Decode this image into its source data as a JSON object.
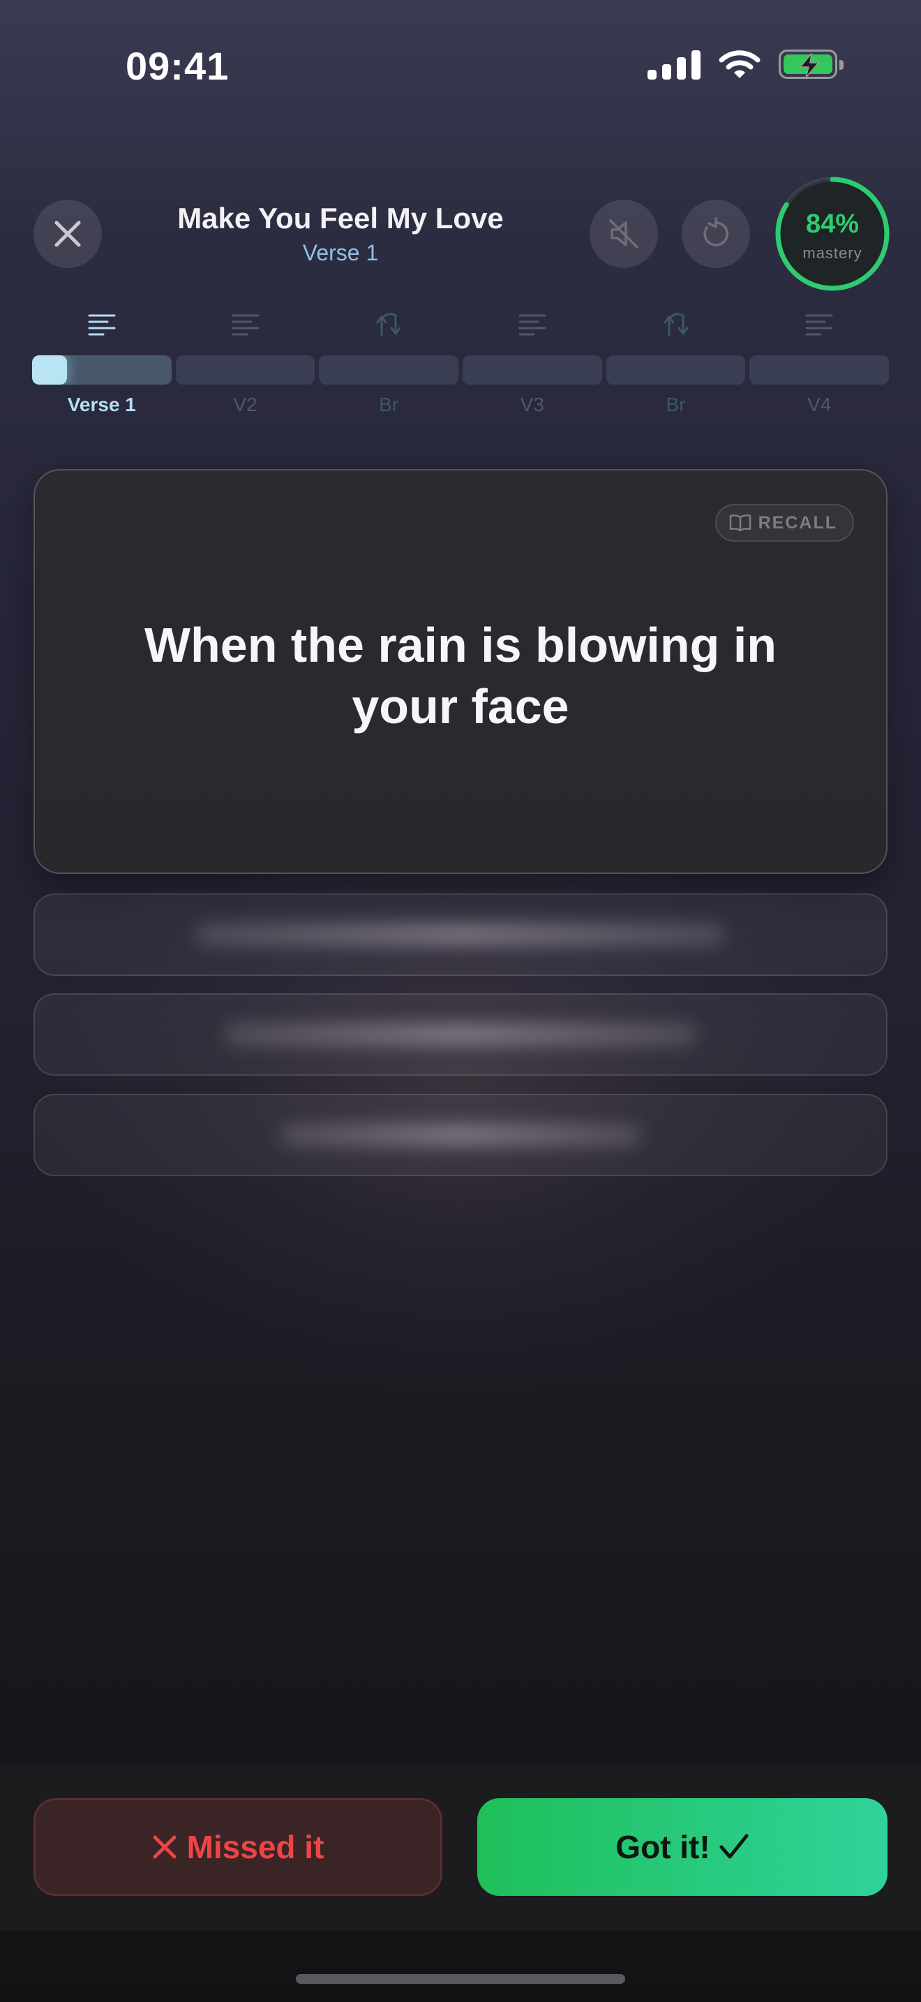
{
  "status_bar": {
    "time": "09:41"
  },
  "header": {
    "song_title": "Make You Feel My Love",
    "section": "Verse 1",
    "mastery_percent": "84%",
    "mastery_value": 0.84,
    "mastery_label": "mastery"
  },
  "progress": {
    "segments": [
      {
        "label": "Verse 1",
        "kind": "verse",
        "state": "current",
        "fill_fraction": 0.25
      },
      {
        "label": "V2",
        "kind": "verse",
        "state": "upcoming",
        "fill_fraction": 0
      },
      {
        "label": "Br",
        "kind": "bridge",
        "state": "upcoming",
        "fill_fraction": 0
      },
      {
        "label": "V3",
        "kind": "verse",
        "state": "upcoming",
        "fill_fraction": 0
      },
      {
        "label": "Br",
        "kind": "bridge",
        "state": "upcoming",
        "fill_fraction": 0
      },
      {
        "label": "V4",
        "kind": "verse",
        "state": "upcoming",
        "fill_fraction": 0
      }
    ]
  },
  "card": {
    "badge": "RECALL",
    "lyric": "When the rain is blowing in your face",
    "hidden_lines_count": 3
  },
  "actions": {
    "missed_label": "Missed it",
    "got_label": "Got it!"
  },
  "colors": {
    "accent_green": "#2ecc71",
    "missed_red": "#ef4444",
    "active_segment": "#b8e4f4",
    "subtitle_blue": "#8ec3e6"
  },
  "icons": [
    "close-icon",
    "mute-icon",
    "restart-icon",
    "book-icon",
    "lines-icon",
    "bridge-icon",
    "x-icon",
    "check-icon",
    "wifi-icon",
    "battery-charging-icon",
    "cellular-signal-icon"
  ]
}
